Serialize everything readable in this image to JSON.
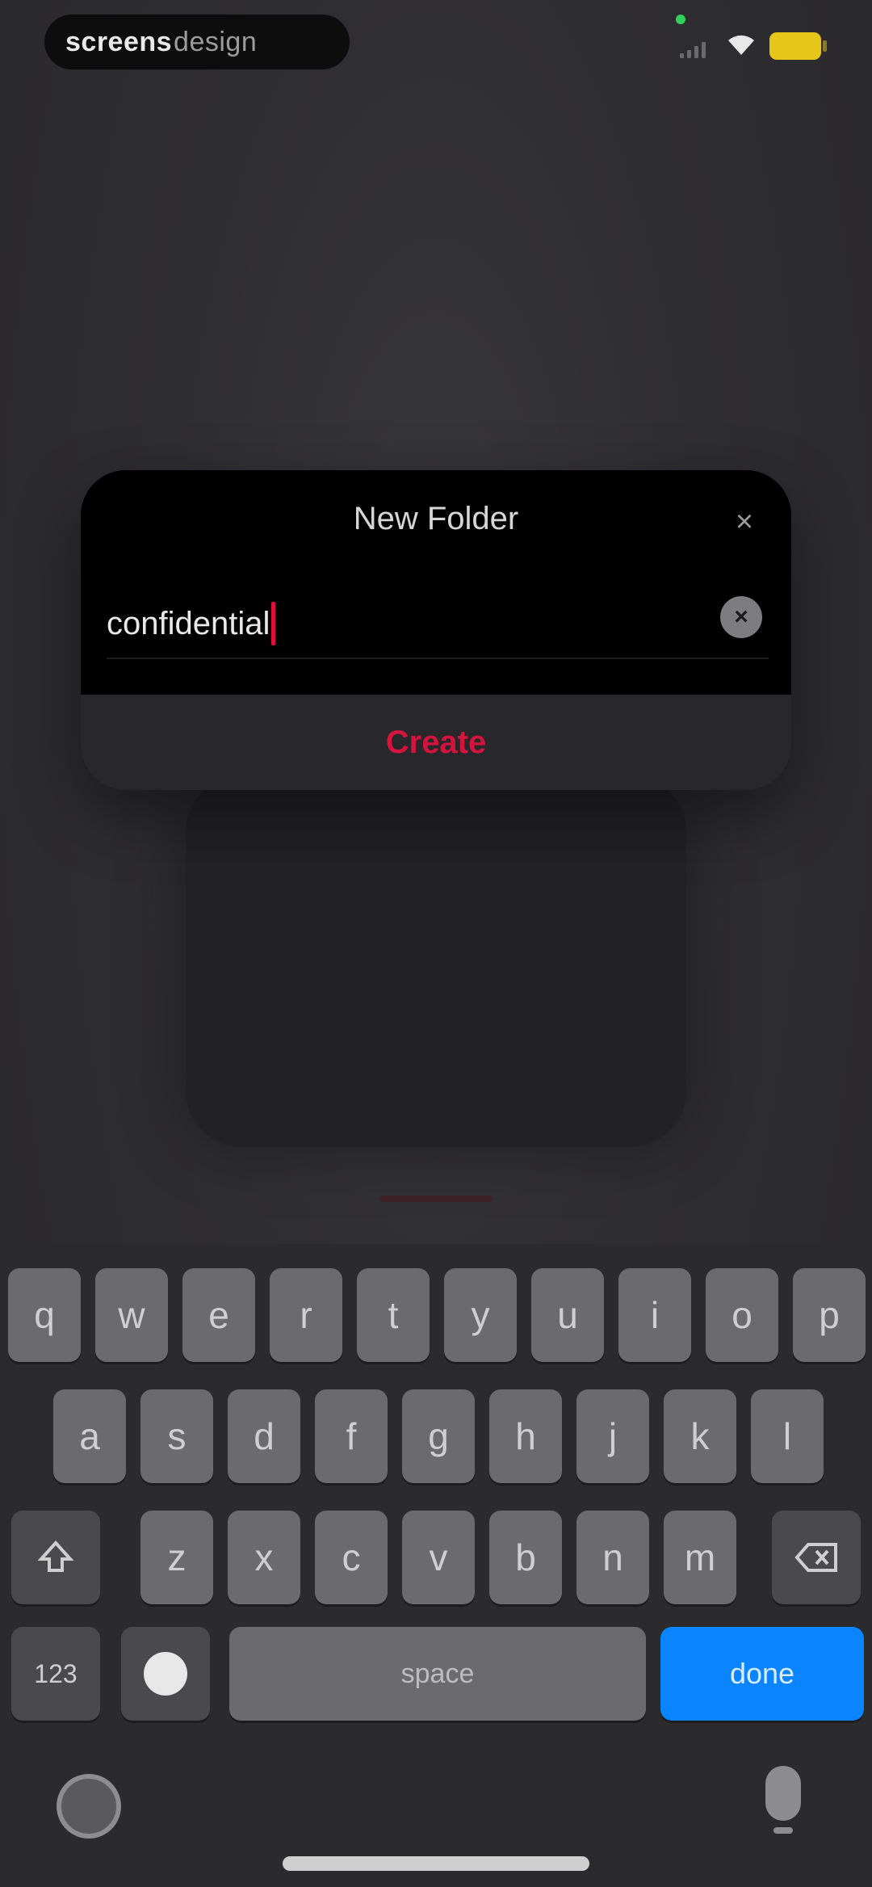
{
  "status_bar": {
    "recorder_bold": "screens",
    "recorder_light": "design",
    "battery_color": "#e6c619"
  },
  "dialog": {
    "title": "New Folder",
    "close_icon": "close-icon",
    "name_value": "confidential",
    "clear_icon": "clear-x-icon",
    "create_label": "Create",
    "accent_color": "#d4143c"
  },
  "keyboard": {
    "row1": [
      "q",
      "w",
      "e",
      "r",
      "t",
      "y",
      "u",
      "i",
      "o",
      "p"
    ],
    "row2": [
      "a",
      "s",
      "d",
      "f",
      "g",
      "h",
      "j",
      "k",
      "l"
    ],
    "row3": [
      "z",
      "x",
      "c",
      "v",
      "b",
      "n",
      "m"
    ],
    "shift_icon": "shift-icon",
    "backspace_icon": "backspace-icon",
    "numbers_label": "123",
    "emoji_icon": "emoji-icon",
    "space_label": "space",
    "done_label": "done",
    "done_color": "#0a84ff",
    "globe_icon": "globe-icon",
    "mic_icon": "microphone-icon"
  }
}
